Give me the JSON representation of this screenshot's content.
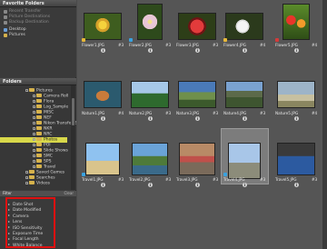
{
  "favorites": {
    "header": "Favorite Folders",
    "items": [
      {
        "label": "Recent Transfer",
        "dim": true
      },
      {
        "label": "Picture Destinations",
        "dim": true
      },
      {
        "label": "Backup Destination",
        "dim": true
      },
      {
        "label": "Desktop",
        "dim": false
      },
      {
        "label": "Pictures",
        "dim": false
      }
    ]
  },
  "folders": {
    "header": "Folders",
    "tree": [
      {
        "label": "Pictures",
        "depth": 1
      },
      {
        "label": "Camera Roll",
        "depth": 2
      },
      {
        "label": "Flora",
        "depth": 2
      },
      {
        "label": "Log_Sample",
        "depth": 2
      },
      {
        "label": "MISC",
        "depth": 2
      },
      {
        "label": "NEF",
        "depth": 2
      },
      {
        "label": "Nikon Transfer 2",
        "depth": 2
      },
      {
        "label": "NKR",
        "depth": 2
      },
      {
        "label": "NRC",
        "depth": 2
      },
      {
        "label": "Photos",
        "depth": 2,
        "selected": true
      },
      {
        "label": "POI",
        "depth": 2
      },
      {
        "label": "Slide Shows",
        "depth": 2
      },
      {
        "label": "SMC",
        "depth": 2
      },
      {
        "label": "SPS",
        "depth": 2
      },
      {
        "label": "Travel",
        "depth": 2
      },
      {
        "label": "Saved Games",
        "depth": 1
      },
      {
        "label": "Searches",
        "depth": 1
      },
      {
        "label": "Videos",
        "depth": 1
      }
    ]
  },
  "filter": {
    "header": "Filter",
    "clear_label": "Clear",
    "items": [
      "Date Shot",
      "Date Modified",
      "Camera",
      "Lens",
      "ISO Sensitivity",
      "Exposure Time",
      "Focal Length",
      "White Balance"
    ]
  },
  "thumbnails": [
    {
      "name": "Flower1.JPG",
      "rating": "#3",
      "badge_color": "#e8b93a"
    },
    {
      "name": "Flower2.JPG",
      "rating": "#3",
      "badge_color": "#39a2e0"
    },
    {
      "name": "Flower3.JPG",
      "rating": "#3",
      "badge_color": ""
    },
    {
      "name": "Flower4.JPG",
      "rating": "#4",
      "badge_color": "#e8b93a"
    },
    {
      "name": "Flower5.JPG",
      "rating": "#4",
      "badge_color": "#d43a3a"
    },
    {
      "name": "Nature1.JPG",
      "rating": "#4",
      "badge_color": ""
    },
    {
      "name": "Nature2.JPG",
      "rating": "#3",
      "badge_color": ""
    },
    {
      "name": "Nature3.JPG",
      "rating": "#3",
      "badge_color": ""
    },
    {
      "name": "Nature4.JPG",
      "rating": "#3",
      "badge_color": ""
    },
    {
      "name": "Nature5.JPG",
      "rating": "#4",
      "badge_color": ""
    },
    {
      "name": "Travel1.JPG",
      "rating": "#3",
      "badge_color": "#39a2e0"
    },
    {
      "name": "Travel2.JPG",
      "rating": "#3",
      "badge_color": ""
    },
    {
      "name": "Travel3.JPG",
      "rating": "#3",
      "badge_color": ""
    },
    {
      "name": "Travel4.JPG",
      "rating": "#3",
      "badge_color": "#39a2e0"
    },
    {
      "name": "Travel5.JPG",
      "rating": "#3",
      "badge_color": ""
    }
  ],
  "colors": {
    "selected_folder": "#d8d84a",
    "filter_highlight": "#e01010",
    "accent": "#f0c419"
  }
}
